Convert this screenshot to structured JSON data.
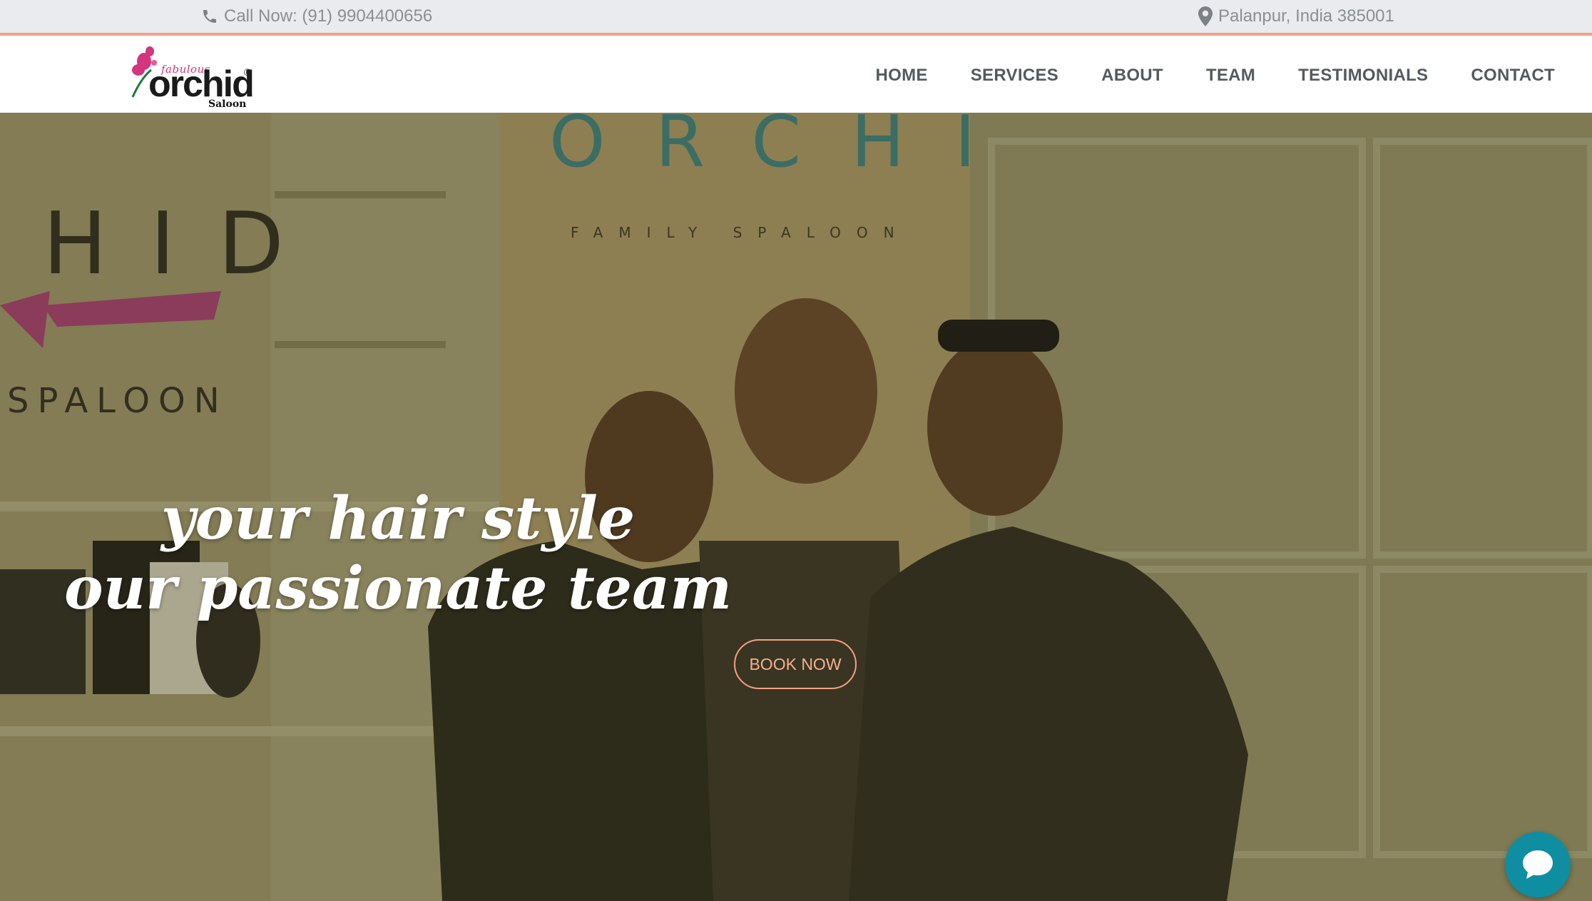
{
  "topbar": {
    "phone_text": "Call Now: (91) 9904400656",
    "location_text": "Palanpur, India 385001",
    "accent_color": "#f4a082"
  },
  "logo": {
    "brand_script": "fabulous",
    "brand_word": "orchid",
    "registered": "®",
    "subtitle": "Saloon"
  },
  "nav": {
    "items": [
      {
        "label": "HOME"
      },
      {
        "label": "SERVICES"
      },
      {
        "label": "ABOUT"
      },
      {
        "label": "TEAM"
      },
      {
        "label": "TESTIMONIALS"
      },
      {
        "label": "CONTACT"
      }
    ]
  },
  "hero": {
    "photo_signs": {
      "sign_left_top": "HID",
      "sign_left_bottom": "SPALOON",
      "sign_center_top": "ORCHID",
      "sign_center_sub": "FAMILY SPALOON"
    },
    "headline_line1": "your hair style",
    "headline_line2": "our passionate team",
    "cta_label": "BOOK NOW"
  },
  "chat": {
    "icon": "chat-bubble-icon",
    "color": "#0e8ea0"
  }
}
